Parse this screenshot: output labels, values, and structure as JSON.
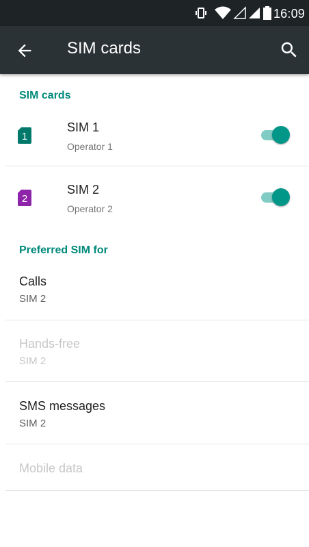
{
  "status_bar": {
    "time": "16:09",
    "icons": [
      "vibrate-icon",
      "wifi-icon",
      "signal-empty-icon",
      "signal-full-icon",
      "battery-icon"
    ]
  },
  "app_bar": {
    "title": "SIM cards",
    "back_icon": "arrow-back-icon",
    "search_icon": "search-icon"
  },
  "sim_section": {
    "header": "SIM cards",
    "sims": [
      {
        "badge": "1",
        "name": "SIM 1",
        "operator": "Operator 1",
        "enabled": true,
        "color": "#00796b"
      },
      {
        "badge": "2",
        "name": "SIM 2",
        "operator": "Operator 2",
        "enabled": true,
        "color": "#8e24aa"
      }
    ]
  },
  "preferred_section": {
    "header": "Preferred SIM for",
    "items": [
      {
        "title": "Calls",
        "value": "SIM 2",
        "enabled": true
      },
      {
        "title": "Hands-free",
        "value": "SIM 2",
        "enabled": false
      },
      {
        "title": "SMS messages",
        "value": "SIM 2",
        "enabled": true
      },
      {
        "title": "Mobile data",
        "value": "",
        "enabled": false
      }
    ]
  },
  "colors": {
    "accent": "#009688",
    "app_bar": "#2b3236",
    "status_bar": "#1e2326"
  }
}
